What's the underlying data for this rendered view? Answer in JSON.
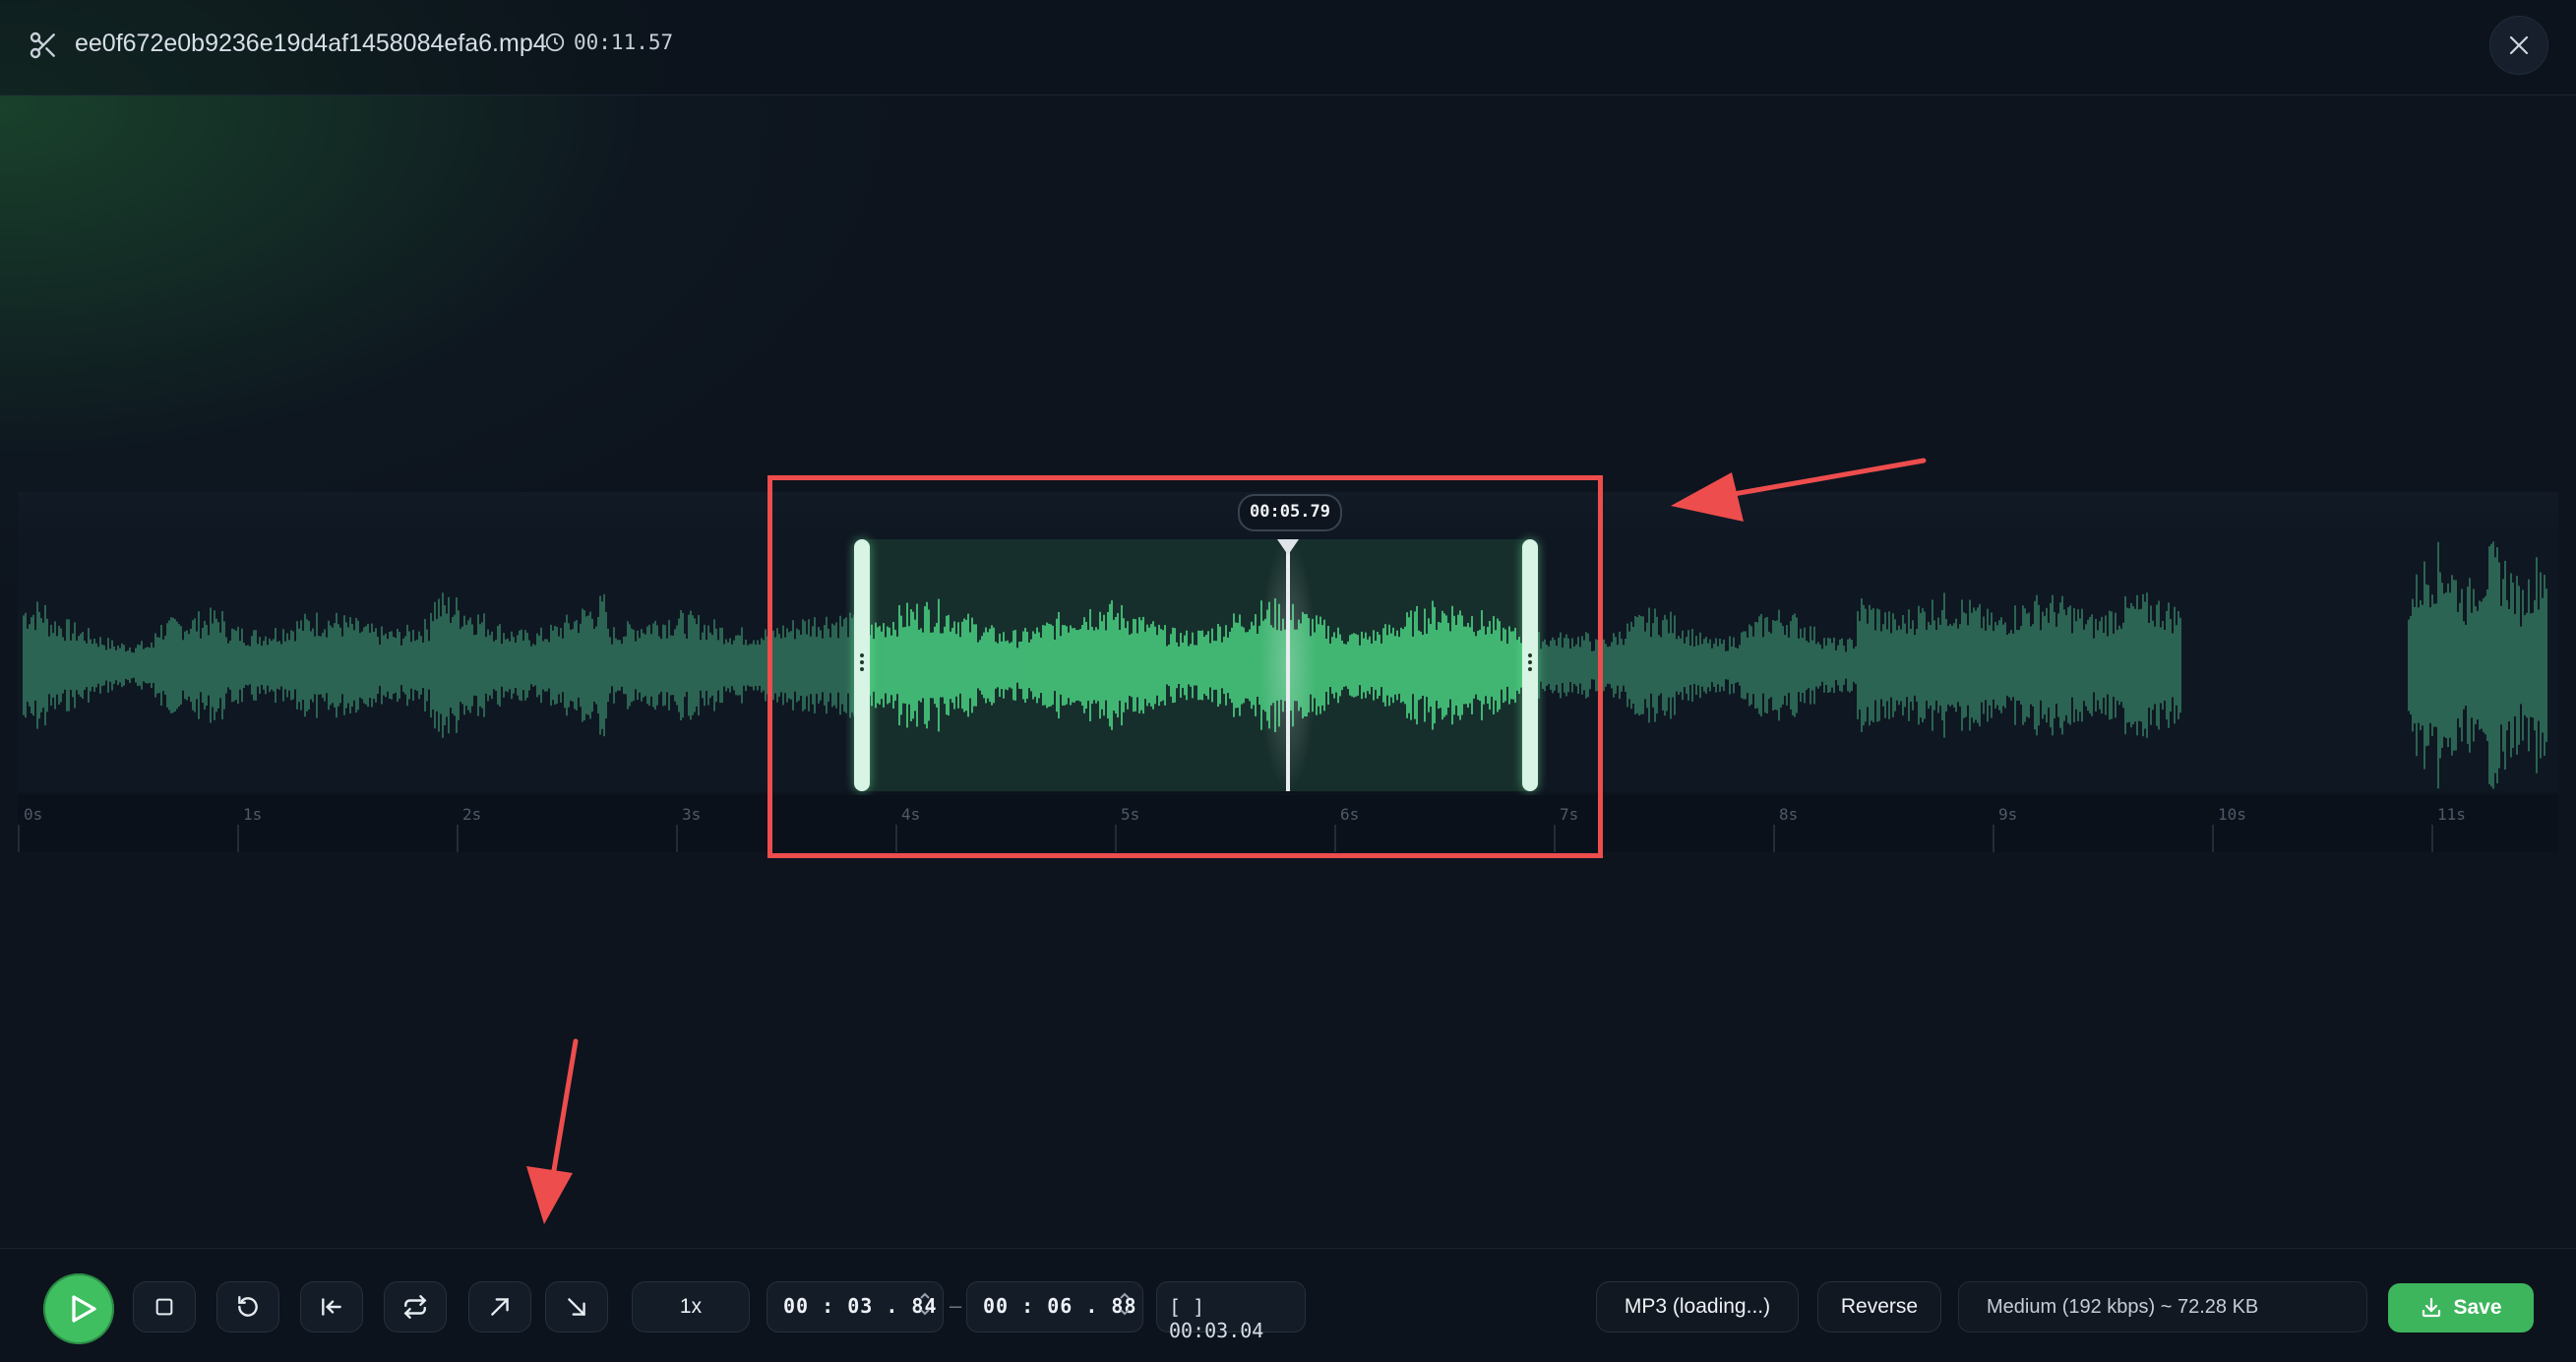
{
  "header": {
    "filename": "ee0f672e0b9236e19d4af1458084efa6.mp4",
    "duration": "00:11.57",
    "icons": {
      "scissors": "scissors-icon",
      "clock": "clock-icon",
      "close": "close-icon"
    }
  },
  "waveform": {
    "total_seconds": 11.57,
    "selection_start_seconds": 3.84,
    "selection_end_seconds": 6.88,
    "playhead_seconds": 5.79,
    "playhead_label": "00:05.79",
    "ruler_labels": [
      "0s",
      "1s",
      "2s",
      "3s",
      "4s",
      "5s",
      "6s",
      "7s",
      "8s",
      "9s",
      "10s",
      "11s"
    ],
    "colors": {
      "wave": "#3f9a74",
      "wave_selected": "#4fe08a",
      "selection_bg": "#1d4a33",
      "playhead": "#e9eef3"
    }
  },
  "controls": {
    "play": "play-icon",
    "stop": "stop-icon",
    "restart": "restart-icon",
    "skip_start": "skip-to-start-icon",
    "loop": "loop-icon",
    "fade_in": "fade-in-icon",
    "fade_out": "fade-out-icon",
    "speed": "1x",
    "start_time": "00 : 03 . 84",
    "end_time": "00 : 06 . 88",
    "separator": "–",
    "selection_length": "[ ] 00:03.04",
    "format": "MP3 (loading...)",
    "reverse": "Reverse",
    "quality": "Medium (192 kbps) ~ 72.28 KB",
    "save": "Save"
  },
  "annotation_color": "#ee4d4d"
}
